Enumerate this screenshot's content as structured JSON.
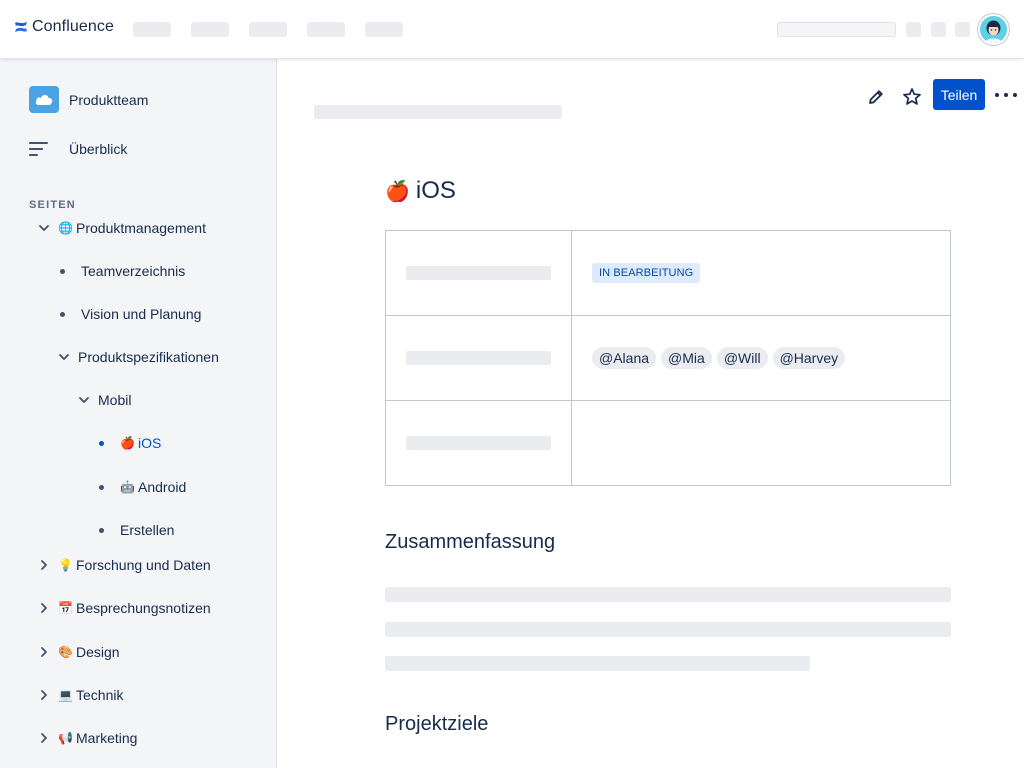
{
  "app": {
    "name": "Confluence",
    "brand_color": "#0052cc"
  },
  "sidebar": {
    "space_name": "Produktteam",
    "overview_label": "Überblick",
    "section_label": "SEITEN",
    "tree": [
      {
        "label": "Produktmanagement",
        "emoji": "🌐",
        "marker": "chevron-down",
        "level": 0
      },
      {
        "label": "Teamverzeichnis",
        "emoji": "",
        "marker": "bullet",
        "level": 1
      },
      {
        "label": "Vision und Planung",
        "emoji": "",
        "marker": "bullet",
        "level": 1
      },
      {
        "label": "Produktspezifikationen",
        "emoji": "",
        "marker": "chevron-down",
        "level": 1
      },
      {
        "label": "Mobil",
        "emoji": "",
        "marker": "chevron-down",
        "level": 2
      },
      {
        "label": "iOS",
        "emoji": "🍎",
        "marker": "bullet",
        "level": 3,
        "active": true
      },
      {
        "label": "Android",
        "emoji": "🤖",
        "marker": "bullet",
        "level": 3
      },
      {
        "label": "Erstellen",
        "emoji": "",
        "marker": "bullet",
        "level": 3
      },
      {
        "label": "Forschung und Daten",
        "emoji": "💡",
        "marker": "chevron-right",
        "level": 0
      },
      {
        "label": "Besprechungsnotizen",
        "emoji": "📅",
        "marker": "chevron-right",
        "level": 0
      },
      {
        "label": "Design",
        "emoji": "🎨",
        "marker": "chevron-right",
        "level": 0
      },
      {
        "label": "Technik",
        "emoji": "💻",
        "marker": "chevron-right",
        "level": 0
      },
      {
        "label": "Marketing",
        "emoji": "📢",
        "marker": "chevron-right",
        "level": 0
      }
    ]
  },
  "toolbar": {
    "share_label": "Teilen",
    "edit_icon": "pencil-icon",
    "star_icon": "star-icon",
    "more_icon": "more-icon"
  },
  "page": {
    "emoji": "🍎",
    "title": "iOS",
    "properties": {
      "status": "IN BEARBEITUNG",
      "mentions": [
        "@Alana",
        "@Mia",
        "@Will",
        "@Harvey"
      ]
    },
    "sections": [
      "Zusammenfassung",
      "Projektziele"
    ]
  }
}
